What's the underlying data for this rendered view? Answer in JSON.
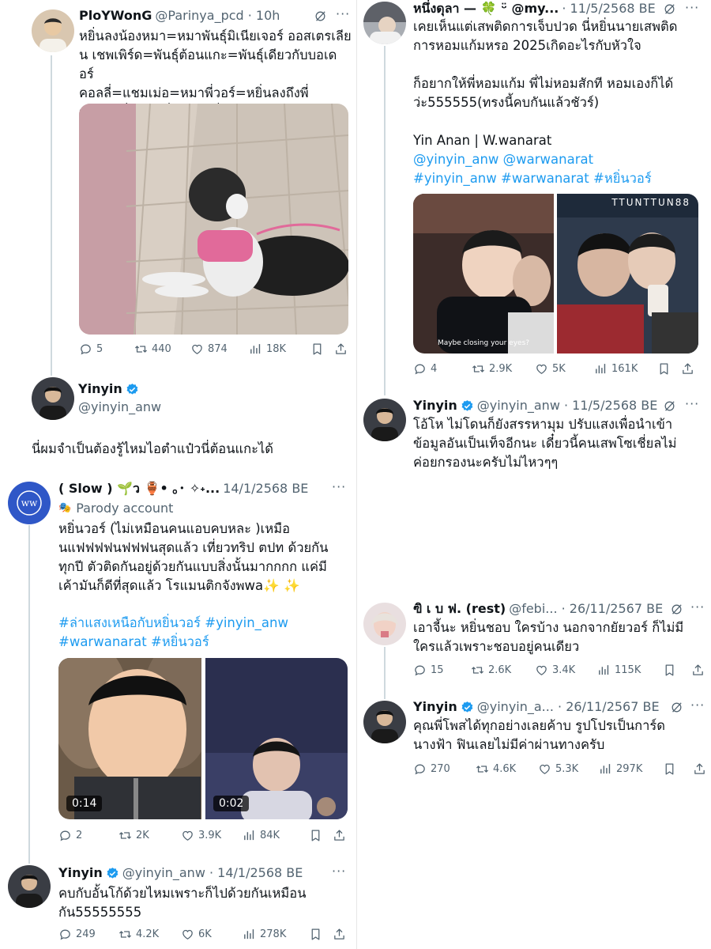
{
  "left": {
    "t1": {
      "name": "PloYWonG",
      "handle": "@Parinya_pcd · 10h",
      "text": "หยิ่นลงน้องหมา=หมาพันธุ์มิเนียเจอร์ ออสเตรเลีย\nน เชพเพิร์ด=พันธุ์ต้อนแกะ=พันธุ์เดียวกับบอเดอร์\nคอลลี่=แชมเม่อ=หมาพี่วอร์=หยิ่นลงถึงพี่\nวอร์=หยิ่นชอบพี่วอร์=หยิ่นวอร์เป็นแฟนกัน",
      "stats": {
        "reply": "5",
        "retweet": "440",
        "like": "874",
        "views": "18K"
      }
    },
    "t2": {
      "name": "Yinyin",
      "handle": "@yinyin_anw",
      "text": "นี่ผมจำเป็นต้องรู้ไหมไอตำแป๋วนี่ต้อนแกะได้"
    },
    "t3": {
      "name": "( Slow ) 🌱ว 🏺• ｡･ ✧˖...",
      "handle": "14/1/2568 BE",
      "parody": "Parody account",
      "text": "หยิ่นวอร์ (ไม่เหมือนคนแอบคบหละ )เหมือ\nนแฟฟฟฟนฟฟฟนสุดแล้ว เที่ยวทริป ตปท ด้วยกัน\nทุกปี ตัวติดกันอยู่ด้วยกันแบบสิ่งนั้นมากกกก แค่มี\nเค้ามันก็ดีที่สุดแล้ว โรแมนติกจังพwa✨ ✨",
      "tags": "#ล่าแสงเหนือกับหยิ่นวอร์ #yinyin_anw\n#warwanarat #หยิ่นวอร์",
      "dur1": "0:14",
      "dur2": "0:02",
      "stats": {
        "reply": "2",
        "retweet": "2K",
        "like": "3.9K",
        "views": "84K"
      }
    },
    "t4": {
      "name": "Yinyin",
      "handle": "@yinyin_anw · 14/1/2568 BE",
      "text": "คบกับอั้นโก้ด้วยไหมเพราะก็ไปด้วยกันเหมือน\nกัน55555555",
      "stats": {
        "reply": "249",
        "retweet": "4.2K",
        "like": "6K",
        "views": "278K"
      }
    }
  },
  "right": {
    "t1": {
      "name": "หนึ่งดุลา — 🍀 ᵕ̈ @my...",
      "handle": "· 11/5/2568 BE",
      "text": "เคยเห็นแต่เสพติดการเจ็บปวด นี่หยิ่นนายเสพติด\nการหอมแก้มหรอ 2025เกิดอะไรกับหัวใจ\n\nก็อยากให้พี่หอมแก้ม พี่ไม่หอมสักที หอมเองก็ได้\nว่ะ555555(ทรงนี้คบกันแล้วชัวร์)\n\nYin Anan | W.wanarat",
      "links": "@yinyin_anw @warwanarat\n#yinyin_anw #warwanarat #หยิ่นวอร์",
      "watermark": "TTUNTTUN88",
      "caption": "Maybe closing your eyes?",
      "stats": {
        "reply": "4",
        "retweet": "2.9K",
        "like": "5K",
        "views": "161K"
      }
    },
    "t2": {
      "name": "Yinyin",
      "handle": "@yinyin_anw · 11/5/2568 BE",
      "text": "โอ้โห ไม่โดนก็ยังสรรหามุม ปรับแสงเพื่อนำเข้า\nข้อมูลอันเป็นเท็จอีกนะ เดี๋ยวนี้คนเสพโซเชี่ยลไม่\nค่อยกรองนะครับไม่ไหวๆๆ"
    },
    "t3": {
      "name": "ฃิ เ บ ฟ. (rest)",
      "handle": "@febi... · 26/11/2567 BE",
      "text": "เอาจี้นะ หยิ่นชอบ ใครบ้าง นอกจากยัยวอร์ ก็ไม่มี\nใครแล้วเพราะชอบอยู่คนเดียว",
      "stats": {
        "reply": "15",
        "retweet": "2.6K",
        "like": "3.4K",
        "views": "115K"
      }
    },
    "t4": {
      "name": "Yinyin",
      "handle": "@yinyin_a... · 26/11/2567 BE",
      "text": "คุณพี่โพสได้ทุกอย่างเลยค้าบ รูปโปรเป็นการ์ด\nนางฟ้า ฟินเลยไม่มีค่าผ่านทางครับ",
      "stats": {
        "reply": "270",
        "retweet": "4.6K",
        "like": "5.3K",
        "views": "297K"
      }
    }
  },
  "colors": {
    "accent": "#1d9bf0",
    "muted": "#536471",
    "text": "#0f1419",
    "thread": "#cfd9de"
  },
  "icons": [
    "reply-icon",
    "retweet-icon",
    "like-icon",
    "views-icon",
    "bookmark-icon",
    "share-icon",
    "verified-icon",
    "grok-icon",
    "more-icon"
  ]
}
